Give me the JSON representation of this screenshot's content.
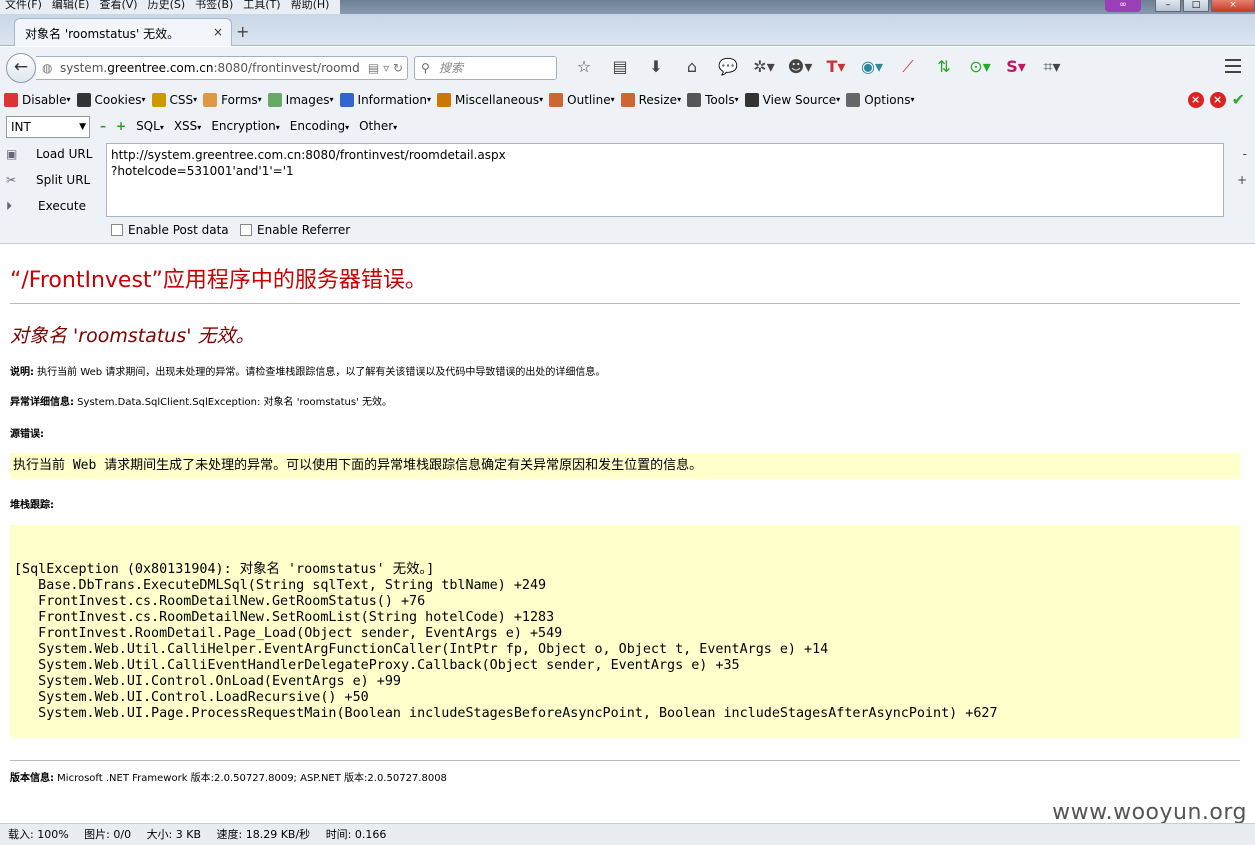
{
  "menubar": {
    "items": [
      "文件(F)",
      "编辑(E)",
      "查看(V)",
      "历史(S)",
      "书签(B)",
      "工具(T)",
      "帮助(H)"
    ]
  },
  "tab": {
    "title": "对象名 'roomstatus' 无效。",
    "close": "×",
    "new": "+"
  },
  "nav": {
    "url_prefix": "system.",
    "url_host": "greentree.com.cn",
    "url_rest": ":8080/frontinvest/roomd",
    "search_placeholder": "搜索"
  },
  "devtoolbar": {
    "items": [
      "Disable",
      "Cookies",
      "CSS",
      "Forms",
      "Images",
      "Information",
      "Miscellaneous",
      "Outline",
      "Resize",
      "Tools",
      "View Source",
      "Options"
    ],
    "icon_colors": [
      "#d33",
      "#333",
      "#c90",
      "#d94",
      "#6a6",
      "#36c",
      "#c70",
      "#c63",
      "#c63",
      "#555",
      "#333",
      "#666"
    ]
  },
  "hackbar": {
    "type_select": "INT",
    "menus": [
      "SQL",
      "XSS",
      "Encryption",
      "Encoding",
      "Other"
    ],
    "load_url": "Load URL",
    "split_url": "Split URL",
    "execute": "Execute",
    "url_value": "http://system.greentree.com.cn:8080/frontinvest/roomdetail.aspx\n?hotelcode=531001'and'1'='1",
    "enable_post": "Enable Post data",
    "enable_referrer": "Enable Referrer"
  },
  "page": {
    "heading": "“/FrontInvest”应用程序中的服务器错误。",
    "subheading": "对象名 'roomstatus' 无效。",
    "desc_label": "说明:",
    "desc_text": " 执行当前 Web 请求期间，出现未处理的异常。请检查堆栈跟踪信息，以了解有关该错误以及代码中导致错误的出处的详细信息。",
    "exception_label": "异常详细信息:",
    "exception_text": " System.Data.SqlClient.SqlException: 对象名 'roomstatus' 无效。",
    "source_error_label": "源错误:",
    "source_error_text": "执行当前 Web 请求期间生成了未处理的异常。可以使用下面的异常堆栈跟踪信息确定有关异常原因和发生位置的信息。",
    "stack_label": "堆栈跟踪:",
    "stack_trace": "[SqlException (0x80131904): 对象名 'roomstatus' 无效。]\n   Base.DbTrans.ExecuteDMLSql(String sqlText, String tblName) +249\n   FrontInvest.cs.RoomDetailNew.GetRoomStatus() +76\n   FrontInvest.cs.RoomDetailNew.SetRoomList(String hotelCode) +1283\n   FrontInvest.RoomDetail.Page_Load(Object sender, EventArgs e) +549\n   System.Web.Util.CalliHelper.EventArgFunctionCaller(IntPtr fp, Object o, Object t, EventArgs e) +14\n   System.Web.Util.CalliEventHandlerDelegateProxy.Callback(Object sender, EventArgs e) +35\n   System.Web.UI.Control.OnLoad(EventArgs e) +99\n   System.Web.UI.Control.LoadRecursive() +50\n   System.Web.UI.Page.ProcessRequestMain(Boolean includeStagesBeforeAsyncPoint, Boolean includeStagesAfterAsyncPoint) +627",
    "version_label": "版本信息:",
    "version_text": " Microsoft .NET Framework 版本:2.0.50727.8009; ASP.NET 版本:2.0.50727.8008"
  },
  "status": {
    "load": "载入: 100%",
    "images": "图片: 0/0",
    "size": "大小: 3 KB",
    "speed": "速度: 18.29 KB/秒",
    "time": "时间: 0.166"
  },
  "watermark": "www.wooyun.org",
  "colors": {
    "error_red": "#cc0000",
    "error_maroon": "#800000",
    "code_bg": "#ffffcc"
  }
}
